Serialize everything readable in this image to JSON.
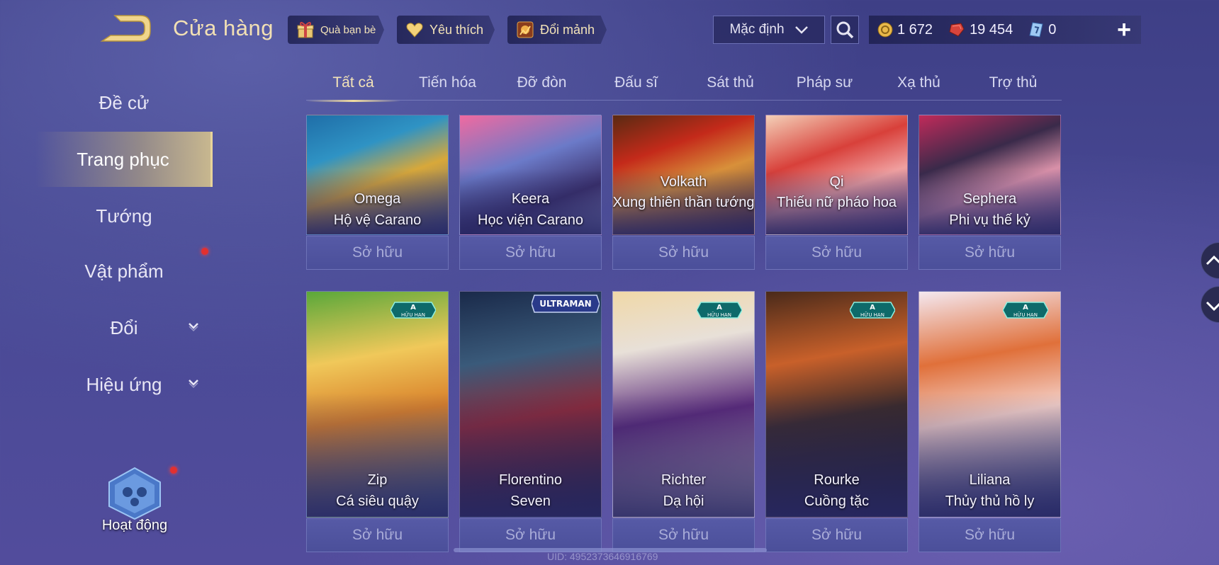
{
  "header": {
    "title": "Cửa hàng",
    "buttons": [
      {
        "label": "Quà bạn bè",
        "icon": "gift-icon"
      },
      {
        "label": "Yêu thích",
        "icon": "heart-icon"
      },
      {
        "label": "Đổi mảnh",
        "icon": "fragment-icon"
      }
    ],
    "sort": {
      "selected": "Mặc định"
    },
    "currencies": [
      {
        "icon": "gold-coin-icon",
        "value": "1 672"
      },
      {
        "icon": "ruby-gem-icon",
        "value": "19 454"
      },
      {
        "icon": "voucher-icon",
        "value": "0"
      }
    ],
    "add_label": "+"
  },
  "sidebar": {
    "items": [
      {
        "label": "Đề cử"
      },
      {
        "label": "Trang phục",
        "active": true
      },
      {
        "label": "Tướng"
      },
      {
        "label": "Vật phẩm",
        "dot": true
      },
      {
        "label": "Đổi",
        "expandable": true
      },
      {
        "label": "Hiệu ứng",
        "expandable": true
      }
    ],
    "activity_label": "Hoạt động"
  },
  "tabs": [
    {
      "label": "Tất cả",
      "active": true
    },
    {
      "label": "Tiến hóa"
    },
    {
      "label": "Đỡ đòn"
    },
    {
      "label": "Đấu sĩ"
    },
    {
      "label": "Sát thủ"
    },
    {
      "label": "Pháp sư"
    },
    {
      "label": "Xạ thủ"
    },
    {
      "label": "Trợ thủ"
    }
  ],
  "owned_label": "Sở hữu",
  "skins_row1": [
    {
      "hero": "Omega",
      "skin": "Hộ vệ Carano"
    },
    {
      "hero": "Keera",
      "skin": "Học viện Carano"
    },
    {
      "hero": "Volkath",
      "skin": "Xung thiên thần tướng"
    },
    {
      "hero": "Qi",
      "skin": "Thiếu nữ pháo hoa"
    },
    {
      "hero": "Sephera",
      "skin": "Phi vụ thế kỷ"
    }
  ],
  "skins_row2": [
    {
      "hero": "Zip",
      "skin": "Cá siêu quậy",
      "badge": "HỮU HẠN",
      "badge_rank": "A"
    },
    {
      "hero": "Florentino",
      "skin": "Seven",
      "badge": "ULTRAMAN"
    },
    {
      "hero": "Richter",
      "skin": "Dạ hội",
      "badge": "HỮU HẠN",
      "badge_rank": "A"
    },
    {
      "hero": "Rourke",
      "skin": "Cuồng tặc",
      "badge": "HỮU HẠN",
      "badge_rank": "A"
    },
    {
      "hero": "Liliana",
      "skin": "Thủy thủ hồ ly",
      "badge": "HỮU HẠN",
      "badge_rank": "A"
    }
  ],
  "footer": {
    "uid": "UID: 4952373646916769"
  },
  "colors": {
    "accent_gold": "#f3e3b8",
    "panel": "#4b4f9a",
    "background": "#444590"
  }
}
